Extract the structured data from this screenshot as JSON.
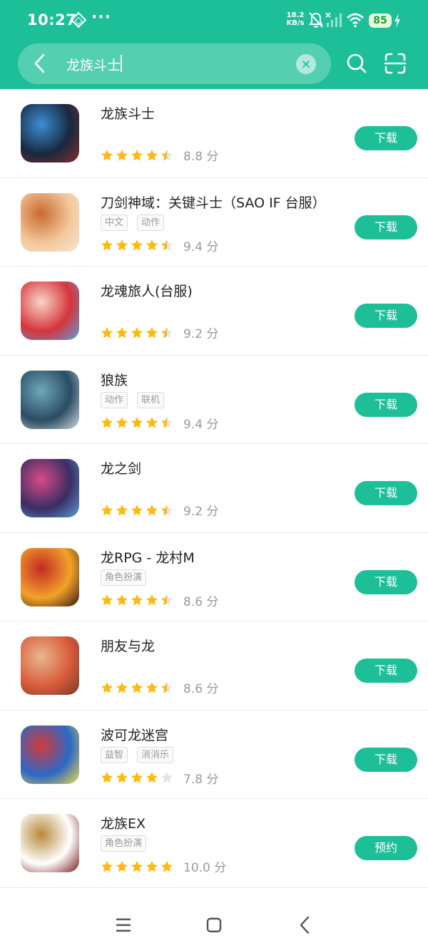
{
  "status_bar": {
    "time": "10:27",
    "dots": "···",
    "net_speed_value": "18.2",
    "net_speed_unit": "KB/s",
    "battery": "85"
  },
  "search": {
    "query": "龙族斗士"
  },
  "apps": [
    {
      "name": "龙族斗士",
      "tags": [],
      "rating": "8.8 分",
      "stars": [
        1,
        1,
        1,
        1,
        0.5
      ],
      "button": "下载",
      "icon_colors": [
        "#17293f",
        "#3d8fd4",
        "#8a2b2b"
      ]
    },
    {
      "name": "刀剑神域：关键斗士（SAO IF 台服）",
      "tags": [
        "中文",
        "动作"
      ],
      "rating": "9.4 分",
      "stars": [
        1,
        1,
        1,
        1,
        0.5
      ],
      "button": "下载",
      "icon_colors": [
        "#f3c79b",
        "#c86a2e",
        "#f7e6d2"
      ]
    },
    {
      "name": "龙魂旅人(台服)",
      "tags": [],
      "rating": "9.2 分",
      "stars": [
        1,
        1,
        1,
        1,
        0.5
      ],
      "button": "下载",
      "icon_colors": [
        "#d6343c",
        "#f9d5c8",
        "#5aa0d8"
      ]
    },
    {
      "name": "狼族",
      "tags": [
        "动作",
        "联机"
      ],
      "rating": "9.4 分",
      "stars": [
        1,
        1,
        1,
        1,
        0.5
      ],
      "button": "下载",
      "icon_colors": [
        "#2b4c63",
        "#6fa7b8",
        "#cfd9de"
      ]
    },
    {
      "name": "龙之剑",
      "tags": [],
      "rating": "9.2 分",
      "stars": [
        1,
        1,
        1,
        1,
        0.5
      ],
      "button": "下载",
      "icon_colors": [
        "#3a2d63",
        "#d94a86",
        "#5a9ed6"
      ]
    },
    {
      "name": "龙RPG - 龙村M",
      "tags": [
        "角色扮演"
      ],
      "rating": "8.6 分",
      "stars": [
        1,
        1,
        1,
        1,
        0.5
      ],
      "button": "下载",
      "icon_colors": [
        "#f2a22b",
        "#c42a24",
        "#3b1a14"
      ]
    },
    {
      "name": "朋友与龙",
      "tags": [],
      "rating": "8.6 分",
      "stars": [
        1,
        1,
        1,
        1,
        0.5
      ],
      "button": "下载",
      "icon_colors": [
        "#d85c3b",
        "#e9b78d",
        "#7a3a2a"
      ]
    },
    {
      "name": "波可龙迷宫",
      "tags": [
        "益智",
        "消消乐"
      ],
      "rating": "7.8 分",
      "stars": [
        1,
        1,
        1,
        1,
        0
      ],
      "button": "下载",
      "icon_colors": [
        "#2a69c6",
        "#d43a3a",
        "#f3d94a"
      ]
    },
    {
      "name": "龙族EX",
      "tags": [
        "角色扮演"
      ],
      "rating": "10.0 分",
      "stars": [
        1,
        1,
        1,
        1,
        1
      ],
      "button": "预约",
      "icon_colors": [
        "#ffffff",
        "#b8893a",
        "#7a1e1e"
      ]
    }
  ],
  "icons": {
    "star_color": "#ffb90f",
    "star_empty_color": "#e3e3e3",
    "accent": "#1dbf98"
  }
}
